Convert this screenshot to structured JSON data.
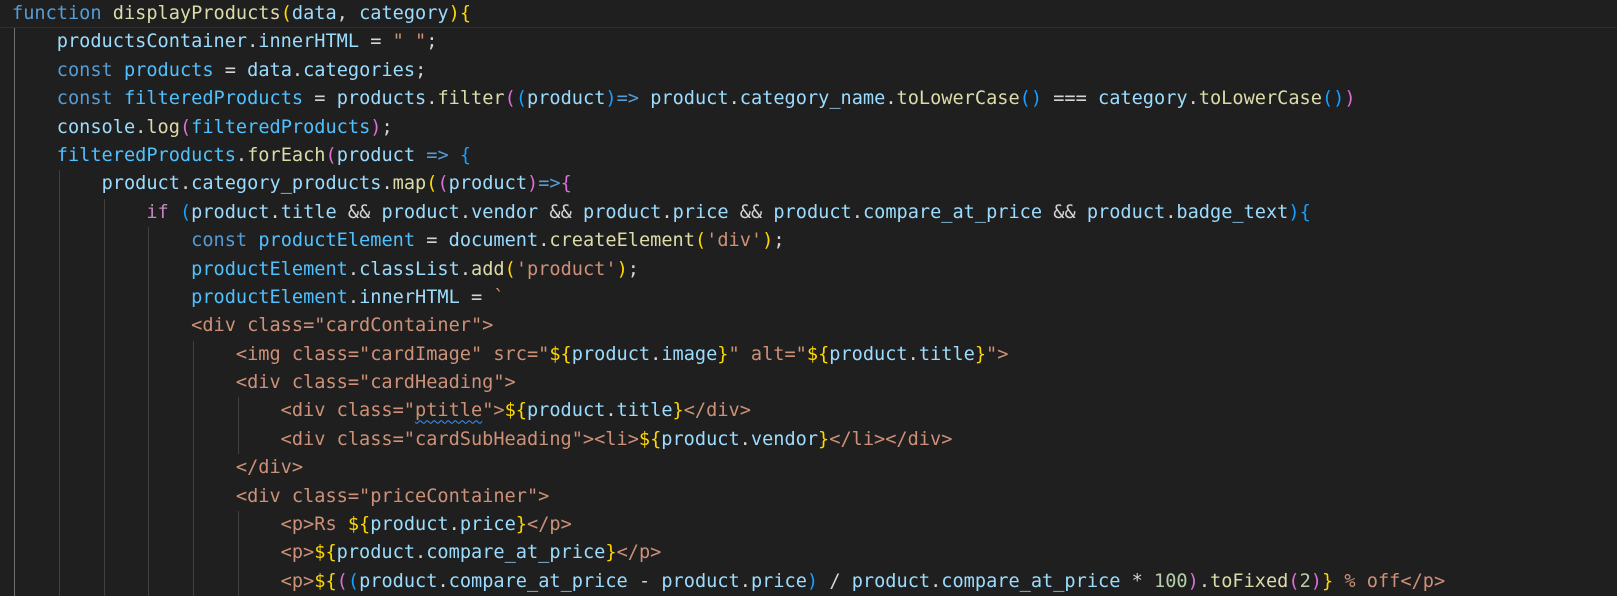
{
  "lines": [
    {
      "indent": 0,
      "current": true,
      "tokens": [
        {
          "t": "function",
          "c": "kw"
        },
        {
          "t": " ",
          "c": "plain"
        },
        {
          "t": "displayProducts",
          "c": "fn"
        },
        {
          "t": "(",
          "c": "b1"
        },
        {
          "t": "data",
          "c": "var"
        },
        {
          "t": ", ",
          "c": "plain"
        },
        {
          "t": "category",
          "c": "var"
        },
        {
          "t": ")",
          "c": "b1"
        },
        {
          "t": "{",
          "c": "b1"
        }
      ]
    },
    {
      "indent": 1,
      "tokens": [
        {
          "t": "productsContainer",
          "c": "var"
        },
        {
          "t": ".",
          "c": "plain"
        },
        {
          "t": "innerHTML",
          "c": "var"
        },
        {
          "t": " = ",
          "c": "op"
        },
        {
          "t": "\" \"",
          "c": "str"
        },
        {
          "t": ";",
          "c": "plain"
        }
      ]
    },
    {
      "indent": 1,
      "tokens": [
        {
          "t": "const",
          "c": "kw"
        },
        {
          "t": " ",
          "c": "plain"
        },
        {
          "t": "products",
          "c": "const"
        },
        {
          "t": " = ",
          "c": "op"
        },
        {
          "t": "data",
          "c": "var"
        },
        {
          "t": ".",
          "c": "plain"
        },
        {
          "t": "categories",
          "c": "var"
        },
        {
          "t": ";",
          "c": "plain"
        }
      ]
    },
    {
      "indent": 1,
      "tokens": [
        {
          "t": "const",
          "c": "kw"
        },
        {
          "t": " ",
          "c": "plain"
        },
        {
          "t": "filteredProducts",
          "c": "const"
        },
        {
          "t": " = ",
          "c": "op"
        },
        {
          "t": "products",
          "c": "var"
        },
        {
          "t": ".",
          "c": "plain"
        },
        {
          "t": "filter",
          "c": "fn"
        },
        {
          "t": "(",
          "c": "b2"
        },
        {
          "t": "(",
          "c": "b3"
        },
        {
          "t": "product",
          "c": "var"
        },
        {
          "t": ")",
          "c": "b3"
        },
        {
          "t": "=>",
          "c": "kw"
        },
        {
          "t": " ",
          "c": "plain"
        },
        {
          "t": "product",
          "c": "var"
        },
        {
          "t": ".",
          "c": "plain"
        },
        {
          "t": "category_name",
          "c": "var"
        },
        {
          "t": ".",
          "c": "plain"
        },
        {
          "t": "toLowerCase",
          "c": "fn"
        },
        {
          "t": "()",
          "c": "b3"
        },
        {
          "t": " === ",
          "c": "op"
        },
        {
          "t": "category",
          "c": "var"
        },
        {
          "t": ".",
          "c": "plain"
        },
        {
          "t": "toLowerCase",
          "c": "fn"
        },
        {
          "t": "()",
          "c": "b3"
        },
        {
          "t": ")",
          "c": "b2"
        }
      ]
    },
    {
      "indent": 1,
      "tokens": [
        {
          "t": "console",
          "c": "var"
        },
        {
          "t": ".",
          "c": "plain"
        },
        {
          "t": "log",
          "c": "fn"
        },
        {
          "t": "(",
          "c": "b2"
        },
        {
          "t": "filteredProducts",
          "c": "const"
        },
        {
          "t": ")",
          "c": "b2"
        },
        {
          "t": ";",
          "c": "plain"
        }
      ]
    },
    {
      "indent": 1,
      "tokens": [
        {
          "t": "filteredProducts",
          "c": "const"
        },
        {
          "t": ".",
          "c": "plain"
        },
        {
          "t": "forEach",
          "c": "fn"
        },
        {
          "t": "(",
          "c": "b2"
        },
        {
          "t": "product",
          "c": "var"
        },
        {
          "t": " ",
          "c": "plain"
        },
        {
          "t": "=>",
          "c": "kw"
        },
        {
          "t": " ",
          "c": "plain"
        },
        {
          "t": "{",
          "c": "b3"
        }
      ]
    },
    {
      "indent": 2,
      "tokens": [
        {
          "t": "product",
          "c": "var"
        },
        {
          "t": ".",
          "c": "plain"
        },
        {
          "t": "category_products",
          "c": "var"
        },
        {
          "t": ".",
          "c": "plain"
        },
        {
          "t": "map",
          "c": "fn"
        },
        {
          "t": "(",
          "c": "b1"
        },
        {
          "t": "(",
          "c": "b2"
        },
        {
          "t": "product",
          "c": "var"
        },
        {
          "t": ")",
          "c": "b2"
        },
        {
          "t": "=>",
          "c": "kw"
        },
        {
          "t": "{",
          "c": "b2"
        }
      ]
    },
    {
      "indent": 3,
      "tokens": [
        {
          "t": "if",
          "c": "ctl"
        },
        {
          "t": " ",
          "c": "plain"
        },
        {
          "t": "(",
          "c": "b3"
        },
        {
          "t": "product",
          "c": "var"
        },
        {
          "t": ".",
          "c": "plain"
        },
        {
          "t": "title",
          "c": "var"
        },
        {
          "t": " && ",
          "c": "op"
        },
        {
          "t": "product",
          "c": "var"
        },
        {
          "t": ".",
          "c": "plain"
        },
        {
          "t": "vendor",
          "c": "var"
        },
        {
          "t": " && ",
          "c": "op"
        },
        {
          "t": "product",
          "c": "var"
        },
        {
          "t": ".",
          "c": "plain"
        },
        {
          "t": "price",
          "c": "var"
        },
        {
          "t": " && ",
          "c": "op"
        },
        {
          "t": "product",
          "c": "var"
        },
        {
          "t": ".",
          "c": "plain"
        },
        {
          "t": "compare_at_price",
          "c": "var"
        },
        {
          "t": " && ",
          "c": "op"
        },
        {
          "t": "product",
          "c": "var"
        },
        {
          "t": ".",
          "c": "plain"
        },
        {
          "t": "badge_text",
          "c": "var"
        },
        {
          "t": ")",
          "c": "b3"
        },
        {
          "t": "{",
          "c": "b3"
        }
      ]
    },
    {
      "indent": 4,
      "tokens": [
        {
          "t": "const",
          "c": "kw"
        },
        {
          "t": " ",
          "c": "plain"
        },
        {
          "t": "productElement",
          "c": "const"
        },
        {
          "t": " = ",
          "c": "op"
        },
        {
          "t": "document",
          "c": "var"
        },
        {
          "t": ".",
          "c": "plain"
        },
        {
          "t": "createElement",
          "c": "fn"
        },
        {
          "t": "(",
          "c": "b1"
        },
        {
          "t": "'div'",
          "c": "str"
        },
        {
          "t": ")",
          "c": "b1"
        },
        {
          "t": ";",
          "c": "plain"
        }
      ]
    },
    {
      "indent": 4,
      "tokens": [
        {
          "t": "productElement",
          "c": "const"
        },
        {
          "t": ".",
          "c": "plain"
        },
        {
          "t": "classList",
          "c": "var"
        },
        {
          "t": ".",
          "c": "plain"
        },
        {
          "t": "add",
          "c": "fn"
        },
        {
          "t": "(",
          "c": "b1"
        },
        {
          "t": "'product'",
          "c": "str"
        },
        {
          "t": ")",
          "c": "b1"
        },
        {
          "t": ";",
          "c": "plain"
        }
      ]
    },
    {
      "indent": 4,
      "tokens": [
        {
          "t": "productElement",
          "c": "const"
        },
        {
          "t": ".",
          "c": "plain"
        },
        {
          "t": "innerHTML",
          "c": "var"
        },
        {
          "t": " = ",
          "c": "op"
        },
        {
          "t": "`",
          "c": "str"
        }
      ]
    },
    {
      "indent": 4,
      "tokens": [
        {
          "t": "<div class=\"cardContainer\">",
          "c": "str"
        }
      ]
    },
    {
      "indent": 5,
      "tokens": [
        {
          "t": "<img class=\"cardImage\" src=\"",
          "c": "str"
        },
        {
          "t": "${",
          "c": "b1"
        },
        {
          "t": "product",
          "c": "var"
        },
        {
          "t": ".",
          "c": "plain"
        },
        {
          "t": "image",
          "c": "var"
        },
        {
          "t": "}",
          "c": "b1"
        },
        {
          "t": "\" alt=\"",
          "c": "str"
        },
        {
          "t": "${",
          "c": "b1"
        },
        {
          "t": "product",
          "c": "var"
        },
        {
          "t": ".",
          "c": "plain"
        },
        {
          "t": "title",
          "c": "var"
        },
        {
          "t": "}",
          "c": "b1"
        },
        {
          "t": "\">",
          "c": "str"
        }
      ]
    },
    {
      "indent": 5,
      "tokens": [
        {
          "t": "<div class=\"cardHeading\">",
          "c": "str"
        }
      ]
    },
    {
      "indent": 6,
      "tokens": [
        {
          "t": "<div class=\"",
          "c": "str"
        },
        {
          "t": "ptitle",
          "c": "str",
          "sq": true
        },
        {
          "t": "\">",
          "c": "str"
        },
        {
          "t": "${",
          "c": "b1"
        },
        {
          "t": "product",
          "c": "var"
        },
        {
          "t": ".",
          "c": "plain"
        },
        {
          "t": "title",
          "c": "var"
        },
        {
          "t": "}",
          "c": "b1"
        },
        {
          "t": "</div>",
          "c": "str"
        }
      ]
    },
    {
      "indent": 6,
      "tokens": [
        {
          "t": "<div class=\"cardSubHeading\"><li>",
          "c": "str"
        },
        {
          "t": "${",
          "c": "b1"
        },
        {
          "t": "product",
          "c": "var"
        },
        {
          "t": ".",
          "c": "plain"
        },
        {
          "t": "vendor",
          "c": "var"
        },
        {
          "t": "}",
          "c": "b1"
        },
        {
          "t": "</li></div>",
          "c": "str"
        }
      ]
    },
    {
      "indent": 5,
      "tokens": [
        {
          "t": "</div>",
          "c": "str"
        }
      ]
    },
    {
      "indent": 5,
      "tokens": [
        {
          "t": "<div class=\"priceContainer\">",
          "c": "str"
        }
      ]
    },
    {
      "indent": 6,
      "tokens": [
        {
          "t": "<p>Rs ",
          "c": "str"
        },
        {
          "t": "${",
          "c": "b1"
        },
        {
          "t": "product",
          "c": "var"
        },
        {
          "t": ".",
          "c": "plain"
        },
        {
          "t": "price",
          "c": "var"
        },
        {
          "t": "}",
          "c": "b1"
        },
        {
          "t": "</p>",
          "c": "str"
        }
      ]
    },
    {
      "indent": 6,
      "tokens": [
        {
          "t": "<p>",
          "c": "str"
        },
        {
          "t": "${",
          "c": "b1"
        },
        {
          "t": "product",
          "c": "var"
        },
        {
          "t": ".",
          "c": "plain"
        },
        {
          "t": "compare_at_price",
          "c": "var"
        },
        {
          "t": "}",
          "c": "b1"
        },
        {
          "t": "</p>",
          "c": "str"
        }
      ]
    },
    {
      "indent": 6,
      "tokens": [
        {
          "t": "<p>",
          "c": "str"
        },
        {
          "t": "${",
          "c": "b1"
        },
        {
          "t": "(",
          "c": "b2"
        },
        {
          "t": "(",
          "c": "b3"
        },
        {
          "t": "product",
          "c": "var"
        },
        {
          "t": ".",
          "c": "plain"
        },
        {
          "t": "compare_at_price",
          "c": "var"
        },
        {
          "t": " - ",
          "c": "op"
        },
        {
          "t": "product",
          "c": "var"
        },
        {
          "t": ".",
          "c": "plain"
        },
        {
          "t": "price",
          "c": "var"
        },
        {
          "t": ")",
          "c": "b3"
        },
        {
          "t": " / ",
          "c": "op"
        },
        {
          "t": "product",
          "c": "var"
        },
        {
          "t": ".",
          "c": "plain"
        },
        {
          "t": "compare_at_price",
          "c": "var"
        },
        {
          "t": " * ",
          "c": "op"
        },
        {
          "t": "100",
          "c": "num"
        },
        {
          "t": ")",
          "c": "b2"
        },
        {
          "t": ".",
          "c": "plain"
        },
        {
          "t": "toFixed",
          "c": "fn"
        },
        {
          "t": "(",
          "c": "b2"
        },
        {
          "t": "2",
          "c": "num"
        },
        {
          "t": ")",
          "c": "b2"
        },
        {
          "t": "}",
          "c": "b1"
        },
        {
          "t": " % off</p>",
          "c": "str"
        }
      ]
    }
  ]
}
